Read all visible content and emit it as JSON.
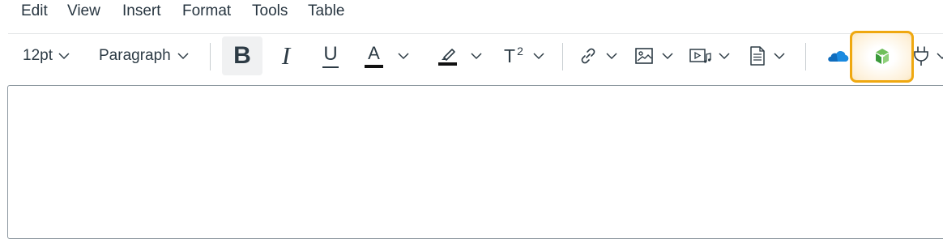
{
  "menubar": {
    "items": [
      "Edit",
      "View",
      "Insert",
      "Format",
      "Tools",
      "Table"
    ]
  },
  "toolbar": {
    "font_size": "12pt",
    "block_format": "Paragraph",
    "bold_label": "B",
    "italic_label": "I",
    "underline_label": "U",
    "text_color_label": "A",
    "superscript_label": "T",
    "superscript_exp": "2",
    "icons": [
      "chevron-down-icon",
      "highlighter-icon",
      "link-icon",
      "image-icon",
      "media-icon",
      "document-icon",
      "onedrive-cloud-icon",
      "studio-app-icon",
      "plug-icon"
    ]
  },
  "colors": {
    "accent_highlight": "#efa810",
    "onedrive_blue": "#0f6cbd",
    "app_green": "#3a9a3a",
    "text": "#2d3b45"
  }
}
